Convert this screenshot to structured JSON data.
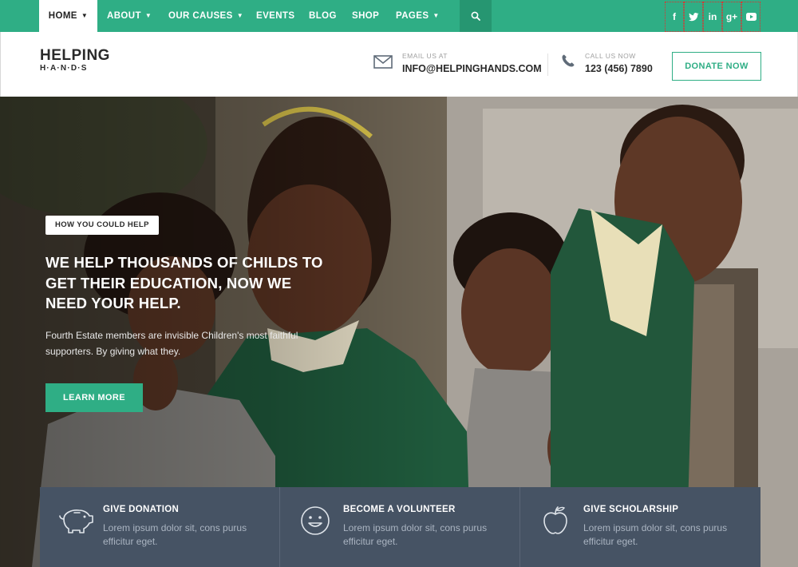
{
  "nav": {
    "items": [
      {
        "label": "HOME",
        "caret": "▼",
        "active": true
      },
      {
        "label": "ABOUT",
        "caret": "▼",
        "active": false
      },
      {
        "label": "OUR CAUSES",
        "caret": "▼",
        "active": false
      },
      {
        "label": "EVENTS",
        "caret": "",
        "active": false
      },
      {
        "label": "BLOG",
        "caret": "",
        "active": false
      },
      {
        "label": "SHOP",
        "caret": "",
        "active": false
      },
      {
        "label": "PAGES",
        "caret": "▼",
        "active": false
      }
    ],
    "search_icon": "search-icon",
    "social": [
      {
        "icon": "facebook-icon",
        "glyph": "f"
      },
      {
        "icon": "twitter-icon",
        "glyph": "t"
      },
      {
        "icon": "linkedin-icon",
        "glyph": "in"
      },
      {
        "icon": "googleplus-icon",
        "glyph": "g+"
      },
      {
        "icon": "youtube-icon",
        "glyph": "▶"
      }
    ]
  },
  "header": {
    "logo_main": "HELPING",
    "logo_sub": "H·A·N·D·S",
    "email_label": "EMAIL US AT",
    "email_value": "INFO@HELPINGHANDS.COM",
    "phone_label": "CALL US NOW",
    "phone_value": "123 (456) 7890",
    "donate_label": "DONATE NOW"
  },
  "hero": {
    "tag": "HOW YOU COULD HELP",
    "headline": "WE HELP THOUSANDS OF CHILDS TO GET THEIR EDUCATION, NOW WE NEED YOUR HELP.",
    "subtext": "Fourth Estate members are invisible Children's most faithful supporters. By giving what they.",
    "button": "LEARN MORE"
  },
  "cards": [
    {
      "title": "GIVE DONATION",
      "text": "Lorem ipsum dolor sit, cons purus efficitur eget.",
      "icon": "piggy-bank-icon"
    },
    {
      "title": "BECOME A VOLUNTEER",
      "text": "Lorem ipsum dolor sit, cons purus efficitur eget.",
      "icon": "smiley-icon"
    },
    {
      "title": "GIVE SCHOLARSHIP",
      "text": "Lorem ipsum dolor sit, cons purus efficitur eget.",
      "icon": "apple-icon"
    }
  ],
  "colors": {
    "accent": "#2fae85",
    "accent_dark": "#269671",
    "card_bg": "#465364",
    "card_text": "#aab4c1"
  }
}
